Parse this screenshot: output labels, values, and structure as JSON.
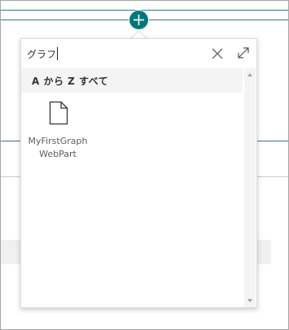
{
  "search": {
    "value": "グラフ",
    "clear_icon": "close-icon",
    "expand_icon": "expand-icon"
  },
  "add_button": {
    "icon": "plus-icon",
    "color": "#03787c"
  },
  "section": {
    "title": "A から Z すべて"
  },
  "webparts": [
    {
      "name": "MyFirstGraph\nWebPart",
      "icon": "document-icon"
    }
  ],
  "scrollbar": {
    "up_icon": "scroll-up-arrow-icon",
    "down_icon": "scroll-down-arrow-icon"
  }
}
